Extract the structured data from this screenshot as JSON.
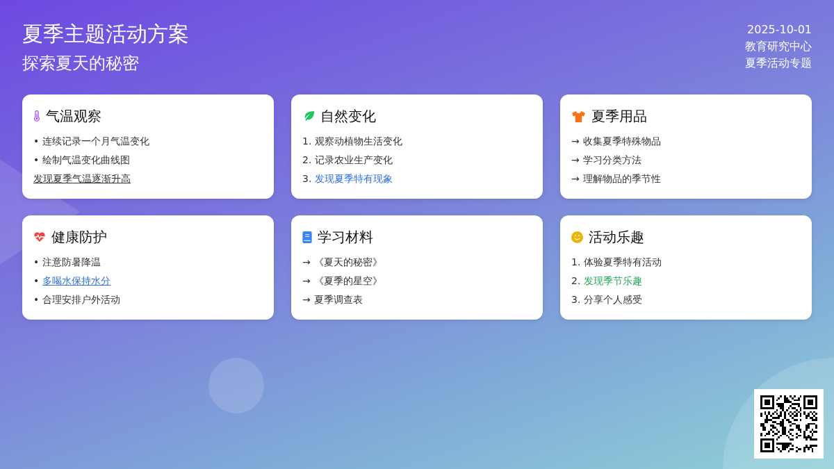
{
  "header": {
    "title": "夏季主题活动方案",
    "subtitle": "探索夏天的秘密",
    "meta": [
      "2025-10-01",
      "教育研究中心",
      "夏季活动专题"
    ]
  },
  "cards": [
    {
      "kind": "thermometer",
      "title": "气温观察",
      "items": [
        {
          "marker": "•",
          "text": "连续记录一个月气温变化",
          "kind": "plain"
        },
        {
          "marker": "•",
          "text": "绘制气温变化曲线图",
          "kind": "plain"
        },
        {
          "text": "发现夏季气温逐渐升高",
          "kind": "underline"
        }
      ]
    },
    {
      "kind": "leaf",
      "title": "自然变化",
      "items": [
        {
          "marker": "1.",
          "text": "观察动植物生活变化",
          "kind": "plain"
        },
        {
          "marker": "2.",
          "text": "记录农业生产变化",
          "kind": "plain"
        },
        {
          "marker": "3.",
          "text": "发现夏季特有现象",
          "kind": "accent",
          "color": "#2f6fde"
        }
      ]
    },
    {
      "kind": "shirt",
      "title": "夏季用品",
      "items": [
        {
          "marker": "→",
          "text": "收集夏季特殊物品",
          "kind": "plain"
        },
        {
          "marker": "→",
          "text": "学习分类方法",
          "kind": "plain"
        },
        {
          "marker": "→",
          "text": "理解物品的季节性",
          "kind": "plain"
        }
      ]
    },
    {
      "kind": "heart",
      "title": "健康防护",
      "items": [
        {
          "marker": "•",
          "text": "注意防暑降温",
          "kind": "plain"
        },
        {
          "marker": "•",
          "text": "多喝水保持水分",
          "kind": "link"
        },
        {
          "marker": "•",
          "text": "合理安排户外活动",
          "kind": "plain"
        }
      ]
    },
    {
      "kind": "book",
      "title": "学习材料",
      "items": [
        {
          "marker": "→",
          "text": "《夏天的秘密》",
          "kind": "plain"
        },
        {
          "marker": "→",
          "text": "《夏季的星空》",
          "kind": "plain"
        },
        {
          "marker": "→",
          "text": "夏季调查表",
          "kind": "plain"
        }
      ]
    },
    {
      "kind": "smile",
      "title": "活动乐趣",
      "items": [
        {
          "marker": "1.",
          "text": "体验夏季特有活动",
          "kind": "plain"
        },
        {
          "marker": "2.",
          "text": "发现季节乐趣",
          "kind": "accent",
          "color": "#22a55a"
        },
        {
          "marker": "3.",
          "text": "分享个人感受",
          "kind": "plain"
        }
      ]
    }
  ]
}
